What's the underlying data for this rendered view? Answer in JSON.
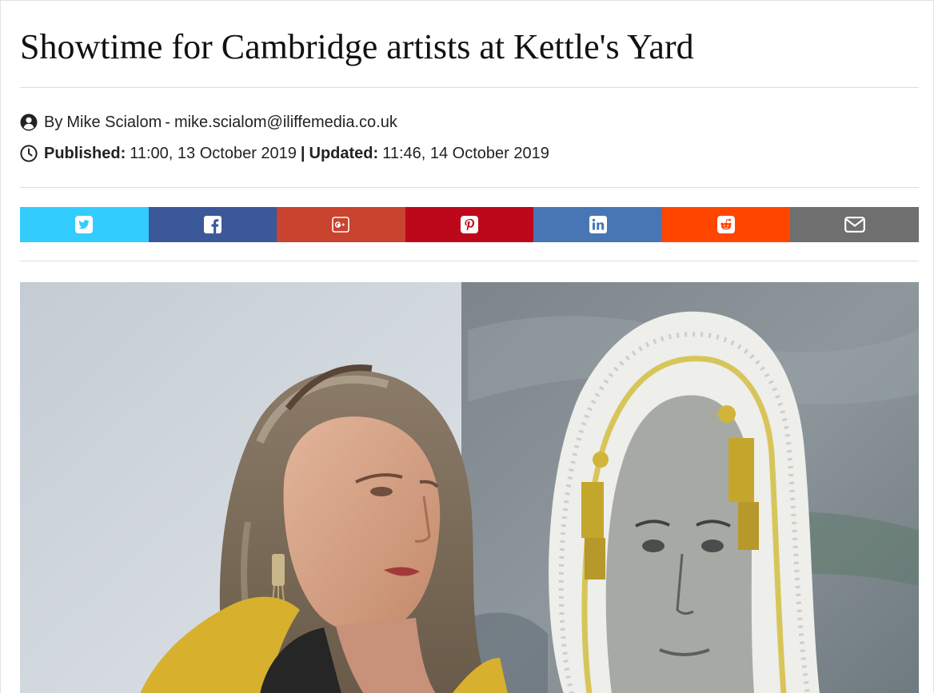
{
  "article": {
    "title": "Showtime for Cambridge artists at Kettle's Yard",
    "byline": {
      "icon": "user-circle-icon",
      "prefix": "By",
      "author": "Mike Scialom",
      "separator": "-",
      "email": "mike.scialom@iliffemedia.co.uk"
    },
    "dates": {
      "icon": "clock-icon",
      "published_label": "Published:",
      "published_value": "11:00, 13 October 2019",
      "divider": "|",
      "updated_label": "Updated:",
      "updated_value": "11:46, 14 October 2019"
    }
  },
  "share": [
    {
      "id": "twitter",
      "icon": "twitter-icon",
      "color": "#33ccff"
    },
    {
      "id": "facebook",
      "icon": "facebook-icon",
      "color": "#3b5998"
    },
    {
      "id": "google-plus",
      "icon": "google-plus-icon",
      "color": "#c9432f"
    },
    {
      "id": "pinterest",
      "icon": "pinterest-icon",
      "color": "#bd081c"
    },
    {
      "id": "linkedin",
      "icon": "linkedin-icon",
      "color": "#4875b4"
    },
    {
      "id": "reddit",
      "icon": "reddit-icon",
      "color": "#ff4500"
    },
    {
      "id": "email",
      "icon": "envelope-icon",
      "color": "#6f6f6f"
    }
  ],
  "hero_image": {
    "subject": "photo of artist standing beside a painted portrait"
  }
}
